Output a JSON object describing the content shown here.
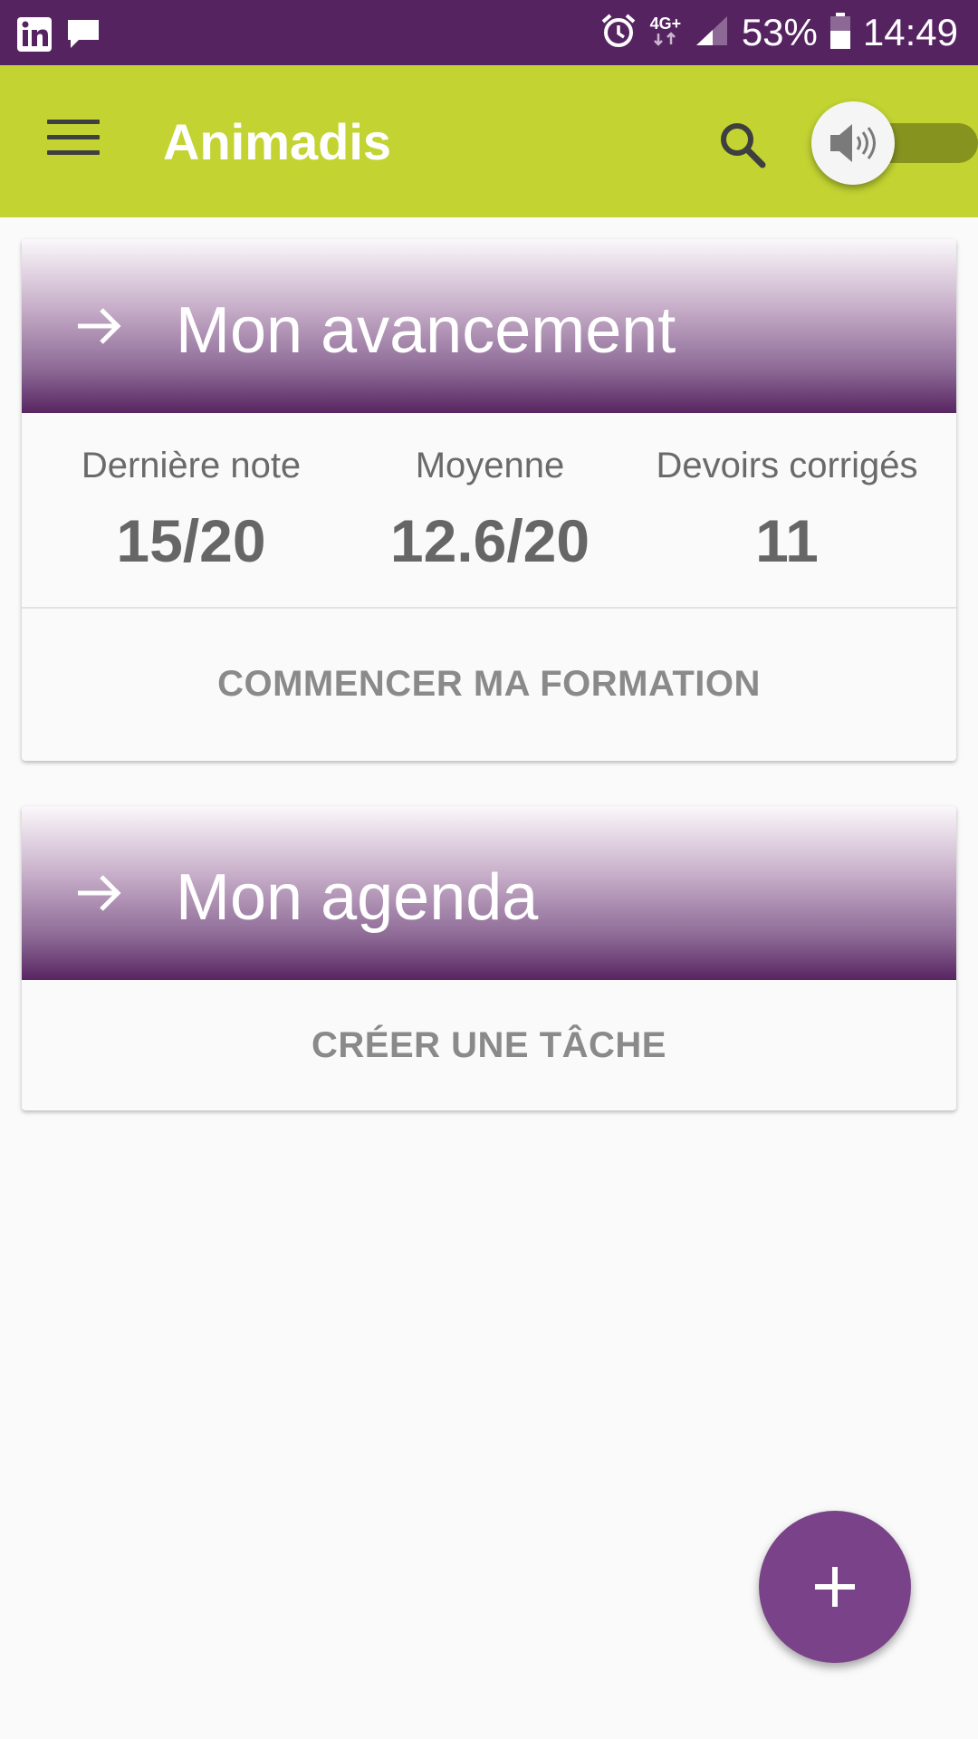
{
  "status_bar": {
    "network": "4G+",
    "battery": "53%",
    "time": "14:49",
    "icons": [
      "linkedin-icon",
      "message-icon",
      "alarm-icon",
      "network-icon",
      "signal-icon",
      "battery-icon"
    ]
  },
  "app_bar": {
    "title": "Animadis",
    "icons": [
      "menu-icon",
      "search-icon",
      "speaker-icon"
    ],
    "accent_color": "#c2d332"
  },
  "progress_card": {
    "title": "Mon avancement",
    "stats": [
      {
        "label": "Dernière note",
        "value": "15/20"
      },
      {
        "label": "Moyenne",
        "value": "12.6/20"
      },
      {
        "label": "Devoirs corrigés",
        "value": "11"
      }
    ],
    "action_label": "COMMENCER MA FORMATION"
  },
  "agenda_card": {
    "title": "Mon agenda",
    "action_label": "CRÉER UNE TÂCHE"
  },
  "fab": {
    "icon": "plus-icon",
    "color": "#7a4289"
  },
  "colors": {
    "status_bar": "#562361",
    "header_dark": "#582562"
  }
}
